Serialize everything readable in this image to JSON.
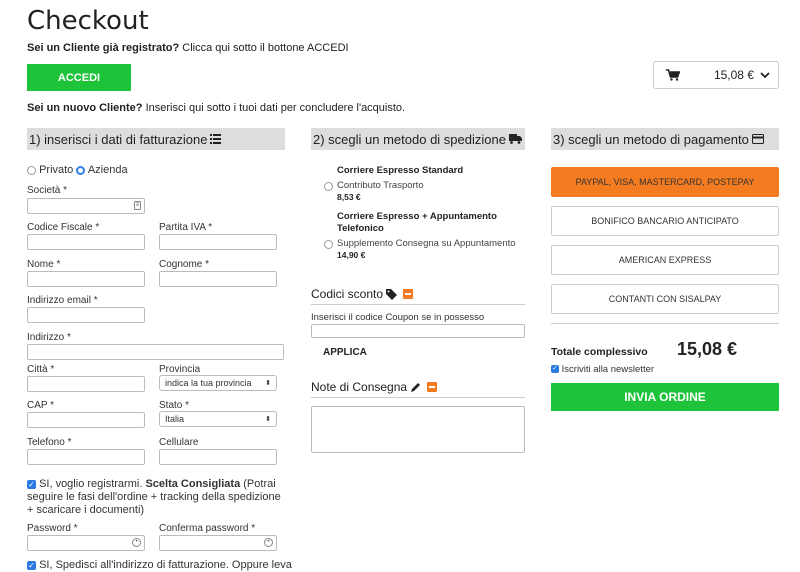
{
  "title": "Checkout",
  "login": {
    "question": "Sei un Cliente già registrato?",
    "hint": "Clicca qui sotto il bottone ACCEDI",
    "button": "ACCEDI"
  },
  "cart": {
    "total": "15,08 €"
  },
  "new_customer": {
    "question": "Sei un nuovo Cliente?",
    "hint": "Inserisci qui sotto i tuoi dati per concludere l'acquisto."
  },
  "billing": {
    "heading": "1) inserisci i dati di fatturazione",
    "type_private": "Privato",
    "type_company": "Azienda",
    "company_label": "Società *",
    "tax_code_label": "Codice Fiscale *",
    "vat_label": "Partita IVA *",
    "name_label": "Nome *",
    "surname_label": "Cognome *",
    "email_label": "Indirizzo email *",
    "address_label": "Indirizzo *",
    "city_label": "Città *",
    "province_label": "Provincia",
    "province_value": "indica la tua provincia",
    "zip_label": "CAP *",
    "country_label": "Stato *",
    "country_value": "Italia",
    "phone_label": "Telefono *",
    "mobile_label": "Cellulare",
    "register_text": "SI, voglio registrarmi.",
    "register_bold": "Scelta Consigliata",
    "register_rest": "(Potrai seguire le fasi dell'ordine + tracking della spedizione + scaricare i documenti)",
    "password_label": "Password *",
    "confirm_password_label": "Conferma password *",
    "ship_to_billing": "SI, Spedisci all'indirizzo di fatturazione. Oppure leva"
  },
  "shipping": {
    "heading": "2) scegli un metodo di spedizione",
    "options": [
      {
        "title": "Corriere Espresso Standard",
        "desc": "Contributo Trasporto",
        "price": "8,53 €"
      },
      {
        "title": "Corriere Espresso + Appuntamento Telefonico",
        "desc": "Supplemento Consegna su Appuntamento",
        "price": "14,90 €"
      }
    ],
    "coupon_heading": "Codici sconto",
    "coupon_label": "Inserisci il codice Coupon se in possesso",
    "apply": "APPLICA",
    "notes_heading": "Note di Consegna"
  },
  "payment": {
    "heading": "3) scegli un metodo di pagamento",
    "methods": [
      "PAYPAL, VISA, MASTERCARD, POSTEPAY",
      "BONIFICO BANCARIO ANTICIPATO",
      "AMERICAN EXPRESS",
      "CONTANTI CON SISALPAY"
    ],
    "total_label": "Totale complessivo",
    "total_value": "15,08 €",
    "newsletter": "Iscriviti alla newsletter",
    "submit": "INVIA ORDINE"
  },
  "colors": {
    "accent_green": "#1ec33a",
    "accent_orange": "#f57b20",
    "section_bg": "#dddddd"
  }
}
